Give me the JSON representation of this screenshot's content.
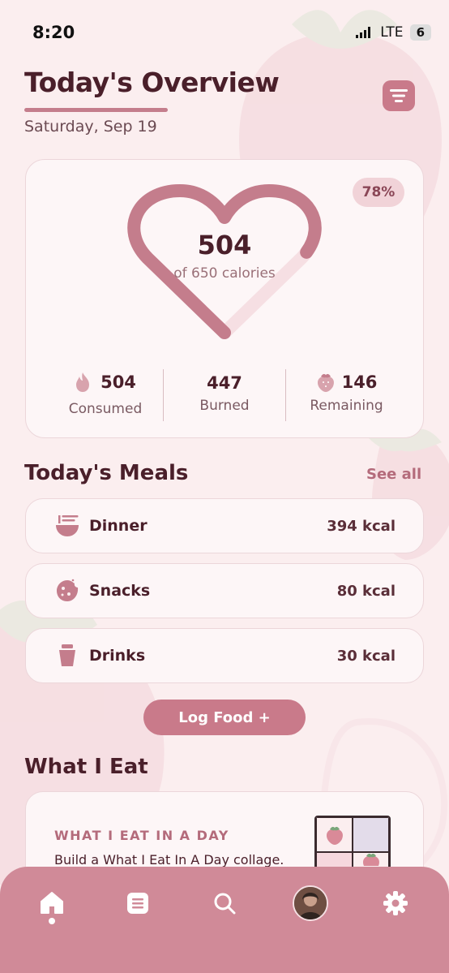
{
  "status_bar": {
    "time": "8:20",
    "network": "LTE",
    "battery": "6"
  },
  "header": {
    "title": "Today's Overview",
    "date": "Saturday, Sep 19",
    "menu_icon": "list-icon"
  },
  "overview": {
    "percent": "78%",
    "progress_fraction": 0.78,
    "consumed_big": "504",
    "goal_text": "of 650 calories",
    "stats": [
      {
        "icon": "flame-icon",
        "value": "504",
        "label": "Consumed"
      },
      {
        "icon": "",
        "value": "447",
        "label": "Burned"
      },
      {
        "icon": "strawberry-icon",
        "value": "146",
        "label": "Remaining"
      }
    ]
  },
  "meals": {
    "title": "Today's Meals",
    "see_all": "See all",
    "items": [
      {
        "icon": "noodle-bowl-icon",
        "name": "Dinner",
        "kcal": "394 kcal"
      },
      {
        "icon": "cookie-icon",
        "name": "Snacks",
        "kcal": "80 kcal"
      },
      {
        "icon": "cup-icon",
        "name": "Drinks",
        "kcal": "30 kcal"
      }
    ],
    "log_button": "Log Food +"
  },
  "what_i_eat": {
    "title": "What I Eat",
    "card_heading": "WHAT I EAT IN A DAY",
    "card_desc": "Build a What I Eat In A Day collage."
  },
  "bottom_nav": {
    "items": [
      "home-icon",
      "list-icon",
      "search-icon",
      "avatar",
      "gear-icon"
    ],
    "active": "home-icon"
  },
  "colors": {
    "accent": "#c97a8a",
    "background": "#fbeeef",
    "text": "#4a1f2a",
    "nav": "#d08a98"
  }
}
